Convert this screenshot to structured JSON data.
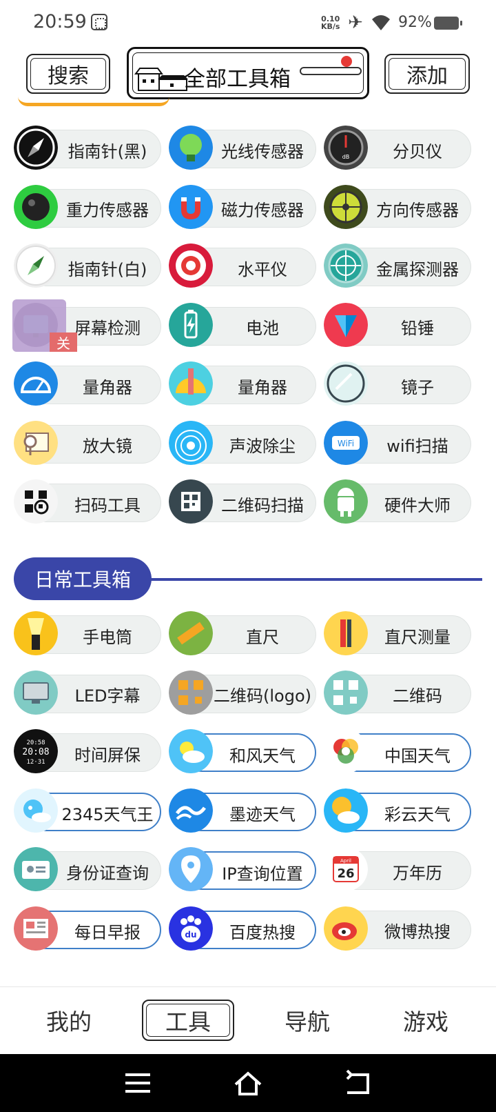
{
  "status_bar": {
    "time": "20:59",
    "net_speed_value": "0.10",
    "net_speed_unit": "KB/s",
    "battery_text": "92%"
  },
  "top_bar": {
    "search_label": "搜索",
    "title": "全部工具箱",
    "add_label": "添加"
  },
  "tools_section": [
    {
      "label": "指南针(黑)",
      "icon": "compass-black-icon"
    },
    {
      "label": "光线传感器",
      "icon": "light-sensor-icon"
    },
    {
      "label": "分贝仪",
      "icon": "decibel-meter-icon"
    },
    {
      "label": "重力传感器",
      "icon": "gravity-sensor-icon"
    },
    {
      "label": "磁力传感器",
      "icon": "magnet-icon"
    },
    {
      "label": "方向传感器",
      "icon": "direction-sensor-icon"
    },
    {
      "label": "指南针(白)",
      "icon": "compass-white-icon"
    },
    {
      "label": "水平仪",
      "icon": "level-target-icon"
    },
    {
      "label": "金属探测器",
      "icon": "metal-detector-icon"
    },
    {
      "label": "屏幕检测",
      "icon": "screen-test-icon"
    },
    {
      "label": "电池",
      "icon": "battery-icon"
    },
    {
      "label": "铅锤",
      "icon": "plumb-bob-icon"
    },
    {
      "label": "量角器",
      "icon": "protractor-icon"
    },
    {
      "label": "量角器",
      "icon": "protractor-ruler-icon"
    },
    {
      "label": "镜子",
      "icon": "mirror-icon"
    },
    {
      "label": "放大镜",
      "icon": "magnifier-icon"
    },
    {
      "label": "声波除尘",
      "icon": "sound-wave-icon"
    },
    {
      "label": "wifi扫描",
      "icon": "wifi-icon"
    },
    {
      "label": "扫码工具",
      "icon": "scan-code-icon"
    },
    {
      "label": "二维码扫描",
      "icon": "qr-scan-icon"
    },
    {
      "label": "硬件大师",
      "icon": "android-icon"
    }
  ],
  "daily_section": {
    "title": "日常工具箱",
    "items": [
      {
        "label": "手电筒",
        "icon": "flashlight-icon"
      },
      {
        "label": "直尺",
        "icon": "ruler-icon"
      },
      {
        "label": "直尺测量",
        "icon": "ruler-pencil-icon"
      },
      {
        "label": "LED字幕",
        "icon": "monitor-icon"
      },
      {
        "label": "二维码(logo)",
        "icon": "qr-logo-icon"
      },
      {
        "label": "二维码",
        "icon": "qr-code-icon"
      },
      {
        "label": "时间屏保",
        "icon": "clock-screensaver-icon"
      },
      {
        "label": "和风天气",
        "icon": "weather-sun-cloud-icon"
      },
      {
        "label": "中国天气",
        "icon": "china-weather-icon"
      },
      {
        "label": "2345天气王",
        "icon": "weather-2345-icon"
      },
      {
        "label": "墨迹天气",
        "icon": "moji-weather-icon"
      },
      {
        "label": "彩云天气",
        "icon": "caiyun-weather-icon"
      },
      {
        "label": "身份证查询",
        "icon": "id-card-icon"
      },
      {
        "label": "IP查询位置",
        "icon": "location-pin-icon"
      },
      {
        "label": "万年历",
        "icon": "calendar-icon"
      },
      {
        "label": "每日早报",
        "icon": "newspaper-icon"
      },
      {
        "label": "百度热搜",
        "icon": "baidu-icon"
      },
      {
        "label": "微博热搜",
        "icon": "weibo-icon"
      }
    ],
    "calendar_month": "April",
    "calendar_day": "26",
    "clock_text_top": "20:58",
    "clock_text_mid": "20:08",
    "clock_text_bottom": "12·31"
  },
  "overlay": {
    "close_label": "关"
  },
  "bottom_nav": {
    "items": [
      "我的",
      "工具",
      "导航",
      "游戏"
    ],
    "active_index": 1
  },
  "colors": {
    "section_blue": "#3a46a8",
    "pill_border_blue": "#3f7fc8",
    "orange_tab": "#f5a623"
  }
}
